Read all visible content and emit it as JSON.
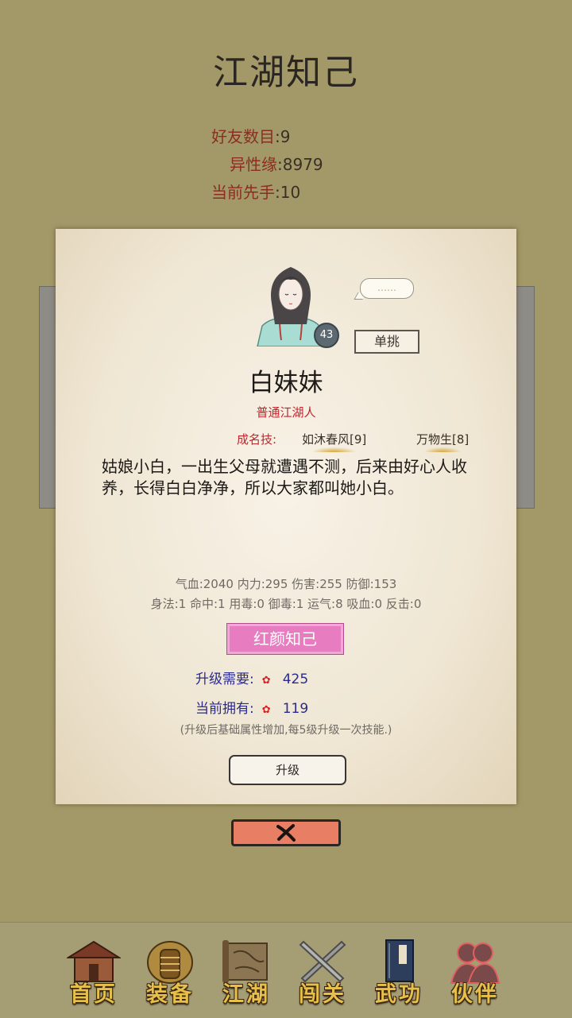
{
  "page": {
    "title": "江湖知己"
  },
  "stats": [
    {
      "label": "好友数目",
      "value": "9"
    },
    {
      "label": "异性缘",
      "value": "8979"
    },
    {
      "label": "当前先手",
      "value": "10"
    }
  ],
  "dialog": {
    "level": "43",
    "speech": "……",
    "duel_label": "单挑",
    "name": "白妹妹",
    "rank": "普通江湖人",
    "skills_label": "成名技:",
    "skills": [
      "如沐春风[9]",
      "万物生[8]"
    ],
    "description": "姑娘小白，一出生父母就遭遇不测，后来由好心人收养，长得白白净净，所以大家都叫她小白。",
    "attributes_line1": "气血:2040  内力:295  伤害:255  防御:153",
    "attributes_line2": "身法:1  命中:1  用毒:0  御毒:1  运气:8  吸血:0  反击:0",
    "hongyan_label": "红颜知己",
    "upgrade_need_label": "升级需要:",
    "upgrade_need_value": "425",
    "current_own_label": "当前拥有:",
    "current_own_value": "119",
    "note": "(升级后基础属性增加,每5级升级一次技能.)",
    "upgrade_label": "升级"
  },
  "nav": [
    {
      "label": "首页",
      "icon": "house-icon"
    },
    {
      "label": "装备",
      "icon": "armor-icon"
    },
    {
      "label": "江湖",
      "icon": "map-scroll-icon"
    },
    {
      "label": "闯关",
      "icon": "crossed-swords-icon"
    },
    {
      "label": "武功",
      "icon": "book-icon"
    },
    {
      "label": "伙伴",
      "icon": "companions-icon"
    }
  ],
  "colors": {
    "background": "#a39968",
    "accent_red": "#c0252e",
    "hongyan_pink": "#e77cc0",
    "close_orange": "#e87f65"
  }
}
